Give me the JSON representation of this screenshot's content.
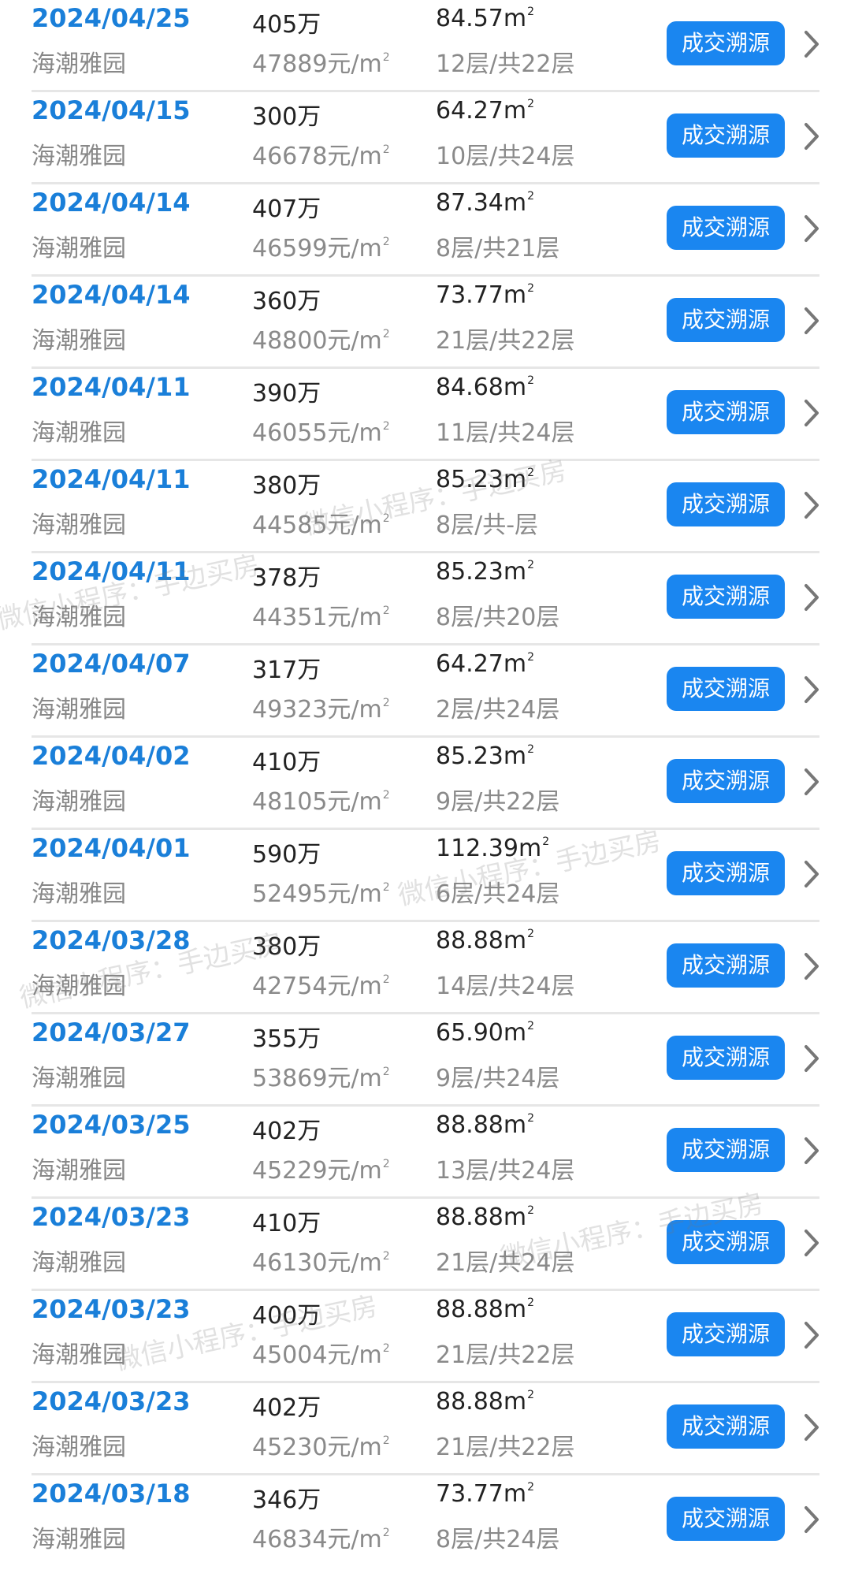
{
  "rows": [
    {
      "date": "2024/04/25",
      "community": "海潮雅园",
      "price": "405万",
      "unit_price": "47889元/m",
      "area": "84.57m",
      "floor": "12层/共22层"
    },
    {
      "date": "2024/04/15",
      "community": "海潮雅园",
      "price": "300万",
      "unit_price": "46678元/m",
      "area": "64.27m",
      "floor": "10层/共24层"
    },
    {
      "date": "2024/04/14",
      "community": "海潮雅园",
      "price": "407万",
      "unit_price": "46599元/m",
      "area": "87.34m",
      "floor": "8层/共21层"
    },
    {
      "date": "2024/04/14",
      "community": "海潮雅园",
      "price": "360万",
      "unit_price": "48800元/m",
      "area": "73.77m",
      "floor": "21层/共22层"
    },
    {
      "date": "2024/04/11",
      "community": "海潮雅园",
      "price": "390万",
      "unit_price": "46055元/m",
      "area": "84.68m",
      "floor": "11层/共24层"
    },
    {
      "date": "2024/04/11",
      "community": "海潮雅园",
      "price": "380万",
      "unit_price": "44585元/m",
      "area": "85.23m",
      "floor": "8层/共-层"
    },
    {
      "date": "2024/04/11",
      "community": "海潮雅园",
      "price": "378万",
      "unit_price": "44351元/m",
      "area": "85.23m",
      "floor": "8层/共20层"
    },
    {
      "date": "2024/04/07",
      "community": "海潮雅园",
      "price": "317万",
      "unit_price": "49323元/m",
      "area": "64.27m",
      "floor": "2层/共24层"
    },
    {
      "date": "2024/04/02",
      "community": "海潮雅园",
      "price": "410万",
      "unit_price": "48105元/m",
      "area": "85.23m",
      "floor": "9层/共22层"
    },
    {
      "date": "2024/04/01",
      "community": "海潮雅园",
      "price": "590万",
      "unit_price": "52495元/m",
      "area": "112.39m",
      "floor": "6层/共24层"
    },
    {
      "date": "2024/03/28",
      "community": "海潮雅园",
      "price": "380万",
      "unit_price": "42754元/m",
      "area": "88.88m",
      "floor": "14层/共24层"
    },
    {
      "date": "2024/03/27",
      "community": "海潮雅园",
      "price": "355万",
      "unit_price": "53869元/m",
      "area": "65.90m",
      "floor": "9层/共24层"
    },
    {
      "date": "2024/03/25",
      "community": "海潮雅园",
      "price": "402万",
      "unit_price": "45229元/m",
      "area": "88.88m",
      "floor": "13层/共24层"
    },
    {
      "date": "2024/03/23",
      "community": "海潮雅园",
      "price": "410万",
      "unit_price": "46130元/m",
      "area": "88.88m",
      "floor": "21层/共24层"
    },
    {
      "date": "2024/03/23",
      "community": "海潮雅园",
      "price": "400万",
      "unit_price": "45004元/m",
      "area": "88.88m",
      "floor": "21层/共22层"
    },
    {
      "date": "2024/03/23",
      "community": "海潮雅园",
      "price": "402万",
      "unit_price": "45230元/m",
      "area": "88.88m",
      "floor": "21层/共22层"
    },
    {
      "date": "2024/03/18",
      "community": "海潮雅园",
      "price": "346万",
      "unit_price": "46834元/m",
      "area": "73.77m",
      "floor": "8层/共24层"
    }
  ],
  "trace_button_label": "成交溯源",
  "square_superscript": "2",
  "watermark_text": "微信小程序：手边买房",
  "colors": {
    "date": "#1a7fd9",
    "button": "#1a86f0",
    "divider": "#e6e6e6"
  },
  "icons": {
    "row_arrow": "chevron-right-icon"
  }
}
